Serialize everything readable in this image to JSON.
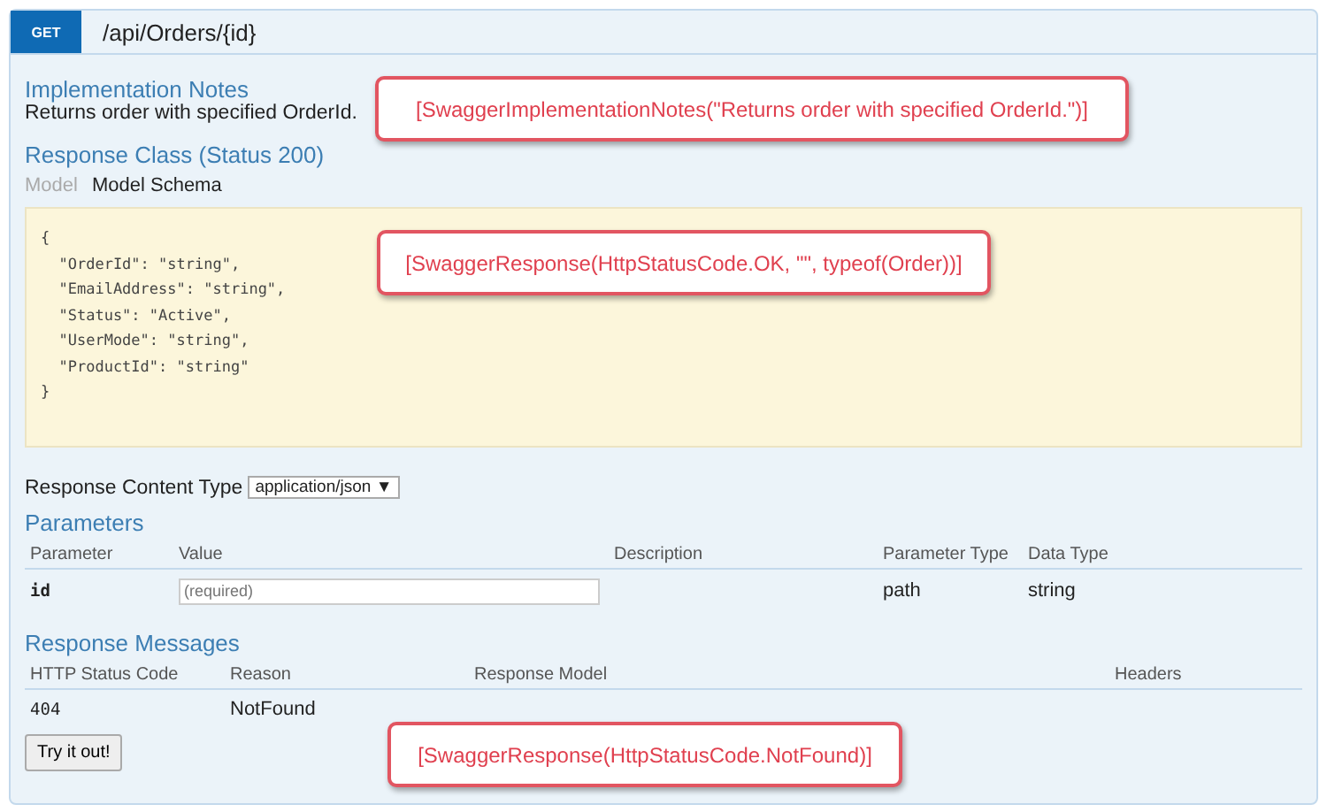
{
  "endpoint": {
    "method": "GET",
    "path": "/api/Orders/{id}"
  },
  "implementation_notes": {
    "title": "Implementation Notes",
    "text": "Returns order with specified OrderId."
  },
  "response_class": {
    "title": "Response Class (Status 200)",
    "tabs": [
      {
        "label": "Model",
        "selected": false
      },
      {
        "label": "Model Schema",
        "selected": true
      }
    ],
    "schema_lines": [
      "{",
      "  \"OrderId\": \"string\",",
      "  \"EmailAddress\": \"string\",",
      "  \"Status\": \"Active\",",
      "  \"UserMode\": \"string\",",
      "  \"ProductId\": \"string\"",
      "}"
    ]
  },
  "response_content_type": {
    "label": "Response Content Type",
    "value": "application/json",
    "caret": "▼"
  },
  "parameters": {
    "title": "Parameters",
    "columns": [
      "Parameter",
      "Value",
      "Description",
      "Parameter Type",
      "Data Type"
    ],
    "rows": [
      {
        "name": "id",
        "placeholder": "(required)",
        "description": "",
        "type": "path",
        "data_type": "string"
      }
    ]
  },
  "response_messages": {
    "title": "Response Messages",
    "columns": [
      "HTTP Status Code",
      "Reason",
      "Response Model",
      "Headers"
    ],
    "rows": [
      {
        "code": "404",
        "reason": "NotFound"
      }
    ]
  },
  "try_button": "Try it out!",
  "callouts": [
    "[SwaggerImplementationNotes(\"Returns order with specified OrderId.\")]",
    "[SwaggerResponse(HttpStatusCode.OK, \"\", typeof(Order))]",
    "[SwaggerResponse(HttpStatusCode.NotFound)]"
  ]
}
